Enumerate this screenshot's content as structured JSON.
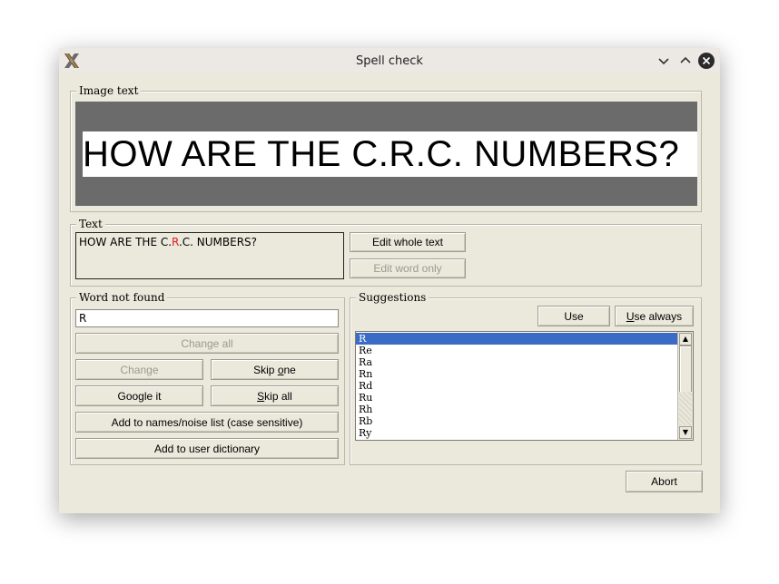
{
  "window": {
    "title": "Spell check",
    "minimize_glyph": "⌄",
    "maximize_glyph": "⌃"
  },
  "image_text": {
    "legend": "Image text",
    "content": "HOW ARE THE C.R.C. NUMBERS?"
  },
  "text_group": {
    "legend": "Text",
    "before": "HOW ARE THE C.",
    "highlight": "R",
    "after": ".C. NUMBERS?",
    "highlight_color": "#e02020",
    "edit_whole_label": "Edit whole text",
    "edit_word_label": "Edit word only"
  },
  "word_not_found": {
    "legend": "Word not found",
    "value": "R",
    "change_all_label": "Change all",
    "change_label": "Change",
    "skip_one_pre": "Skip ",
    "skip_one_ul": "o",
    "skip_one_post": "ne",
    "google_label": "Google it",
    "skip_all_ul": "S",
    "skip_all_post": "kip all",
    "add_names_label": "Add to names/noise list (case sensitive)",
    "add_user_dict_label": "Add to user dictionary"
  },
  "suggestions": {
    "legend": "Suggestions",
    "use_label": "Use",
    "use_always_ul": "U",
    "use_always_post": "se always",
    "items": [
      "R",
      "Re",
      "Ra",
      "Rn",
      "Rd",
      "Ru",
      "Rh",
      "Rb",
      "Ry"
    ],
    "selected_color": "#3a6cc6"
  },
  "footer": {
    "abort_label": "Abort"
  }
}
